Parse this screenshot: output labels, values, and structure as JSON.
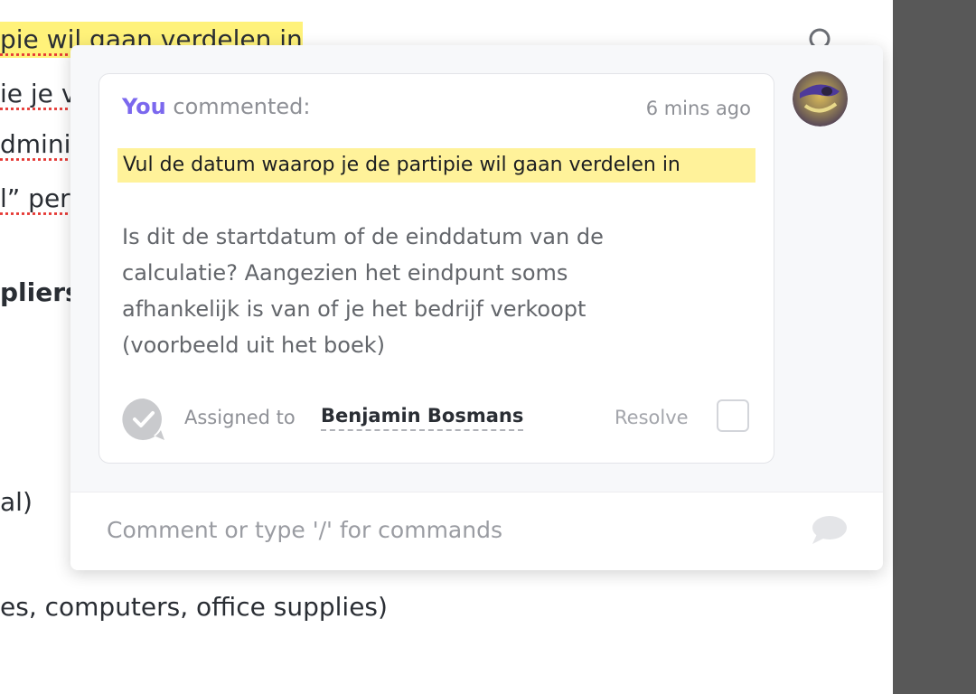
{
  "document": {
    "lines": [
      "pie wil gaan verdelen in",
      "ie je v",
      "dmini",
      "l” per",
      "pliers",
      "al)",
      "es, computers, office supplies)"
    ]
  },
  "comment": {
    "author": "You",
    "action": "commented:",
    "timestamp": "6 mins ago",
    "quote": "Vul de datum waarop je de partipie wil gaan verdelen in",
    "body_lines": [
      "Is dit de startdatum of de einddatum van de",
      "calculatie? Aangezien het eindpunt soms",
      "afhankelijk is van of je het bedrijf verkoopt",
      "(voorbeeld uit het boek)"
    ],
    "assigned_label": "Assigned to",
    "assignee": "Benjamin Bosmans",
    "resolve_label": "Resolve",
    "resolved": false
  },
  "composer": {
    "placeholder": "Comment or type '/' for commands"
  },
  "colors": {
    "accent": "#7b68ee",
    "highlight": "#fff29a",
    "sidebar": "#585858"
  },
  "icons": {
    "search": "search-icon",
    "assign": "check-bubble-icon",
    "send": "chat-bubble-icon"
  }
}
